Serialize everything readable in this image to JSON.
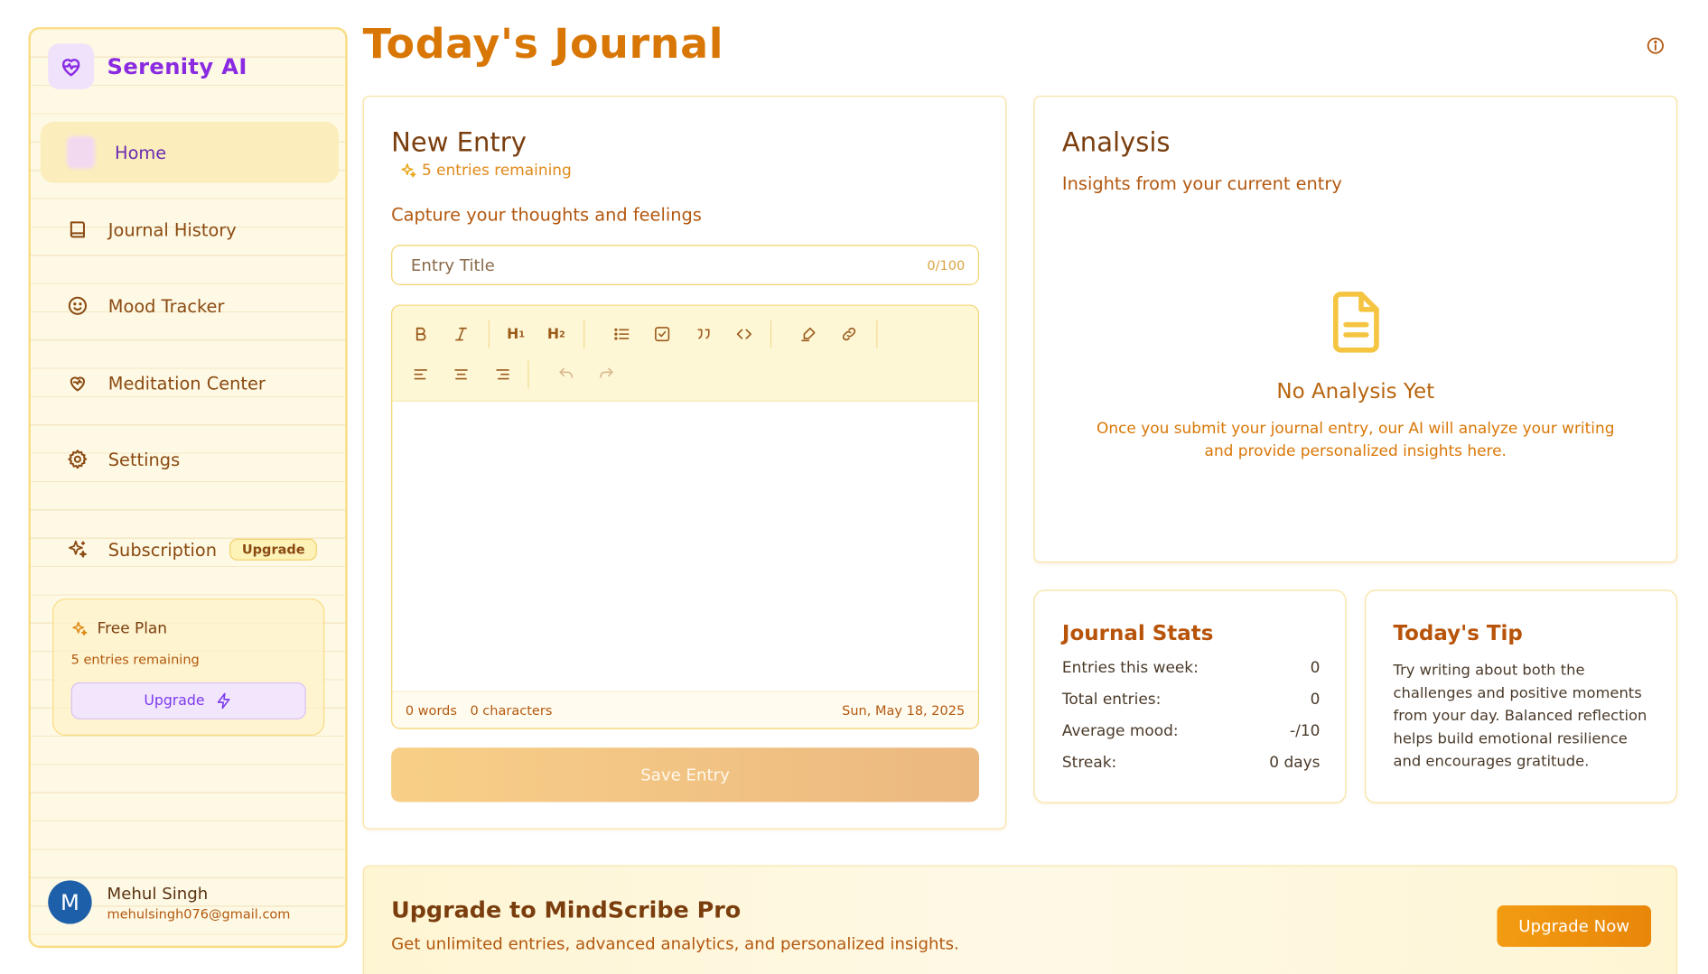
{
  "brand": {
    "name": "Serenity AI"
  },
  "sidebar": {
    "items": [
      {
        "label": "Home"
      },
      {
        "label": "Journal History"
      },
      {
        "label": "Mood Tracker"
      },
      {
        "label": "Meditation Center"
      },
      {
        "label": "Settings"
      },
      {
        "label": "Subscription",
        "badge": "Upgrade"
      }
    ],
    "plan": {
      "title": "Free Plan",
      "remaining": "5 entries remaining",
      "button": "Upgrade"
    },
    "user": {
      "initial": "M",
      "name": "Mehul Singh",
      "email": "mehulsingh076@gmail.com"
    }
  },
  "header": {
    "title": "Today's Journal"
  },
  "new_entry": {
    "title": "New Entry",
    "remaining": "5 entries remaining",
    "subtitle": "Capture your thoughts and feelings",
    "title_placeholder": "Entry Title",
    "title_counter": "0/100",
    "toolbar": {
      "h1": "H",
      "h1_sub": "1",
      "h2": "H",
      "h2_sub": "2"
    },
    "words": "0 words",
    "characters": "0 characters",
    "date": "Sun, May 18, 2025",
    "save_label": "Save Entry"
  },
  "analysis": {
    "title": "Analysis",
    "subtitle": "Insights from your current entry",
    "empty_title": "No Analysis Yet",
    "empty_line1": "Once you submit your journal entry, our AI will analyze your writing",
    "empty_line2": "and provide personalized insights here."
  },
  "stats": {
    "title": "Journal Stats",
    "rows": [
      {
        "label": "Entries this week:",
        "value": "0"
      },
      {
        "label": "Total entries:",
        "value": "0"
      },
      {
        "label": "Average mood:",
        "value": "-/10"
      },
      {
        "label": "Streak:",
        "value": "0 days"
      }
    ]
  },
  "tip": {
    "title": "Today's Tip",
    "lines": [
      "Try writing about both the",
      "challenges and positive moments",
      "from your day. Balanced reflection",
      "helps build emotional resilience",
      "and encourages gratitude."
    ]
  },
  "banner": {
    "title": "Upgrade to MindScribe Pro",
    "subtitle": "Get unlimited entries, advanced analytics, and personalized insights.",
    "button": "Upgrade Now"
  },
  "colors": {
    "accent": "#d97706",
    "brand": "#8a2be2",
    "text_brown": "#8a4a12",
    "border_yellow": "#f8e3a2"
  },
  "icons": {
    "brand": "heart-pulse-icon",
    "home": "home-icon",
    "journal_history": "book-icon",
    "mood_tracker": "smile-icon",
    "meditation": "heart-icon",
    "settings": "gear-icon",
    "subscription": "sparkles-icon",
    "empty_analysis": "document-icon"
  }
}
